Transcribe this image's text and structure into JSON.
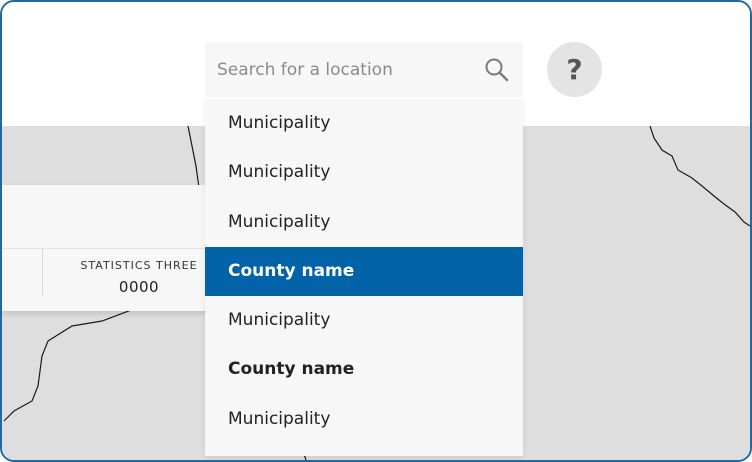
{
  "search": {
    "placeholder": "Search for a location"
  },
  "help": {
    "label": "?"
  },
  "stats": {
    "label": "STATISTICS THREE",
    "value": "0000"
  },
  "dropdown": {
    "items": [
      {
        "label": "Municipality",
        "type": "municipality",
        "selected": false
      },
      {
        "label": "Municipality",
        "type": "municipality",
        "selected": false
      },
      {
        "label": "Municipality",
        "type": "municipality",
        "selected": false
      },
      {
        "label": "County name",
        "type": "county",
        "selected": true
      },
      {
        "label": "Municipality",
        "type": "municipality",
        "selected": false
      },
      {
        "label": "County name",
        "type": "county",
        "selected": false
      },
      {
        "label": "Municipality",
        "type": "municipality",
        "selected": false
      }
    ]
  },
  "colors": {
    "accent": "#0263a8",
    "frame_border": "#1f6aa5",
    "map_fill": "#dedede"
  }
}
